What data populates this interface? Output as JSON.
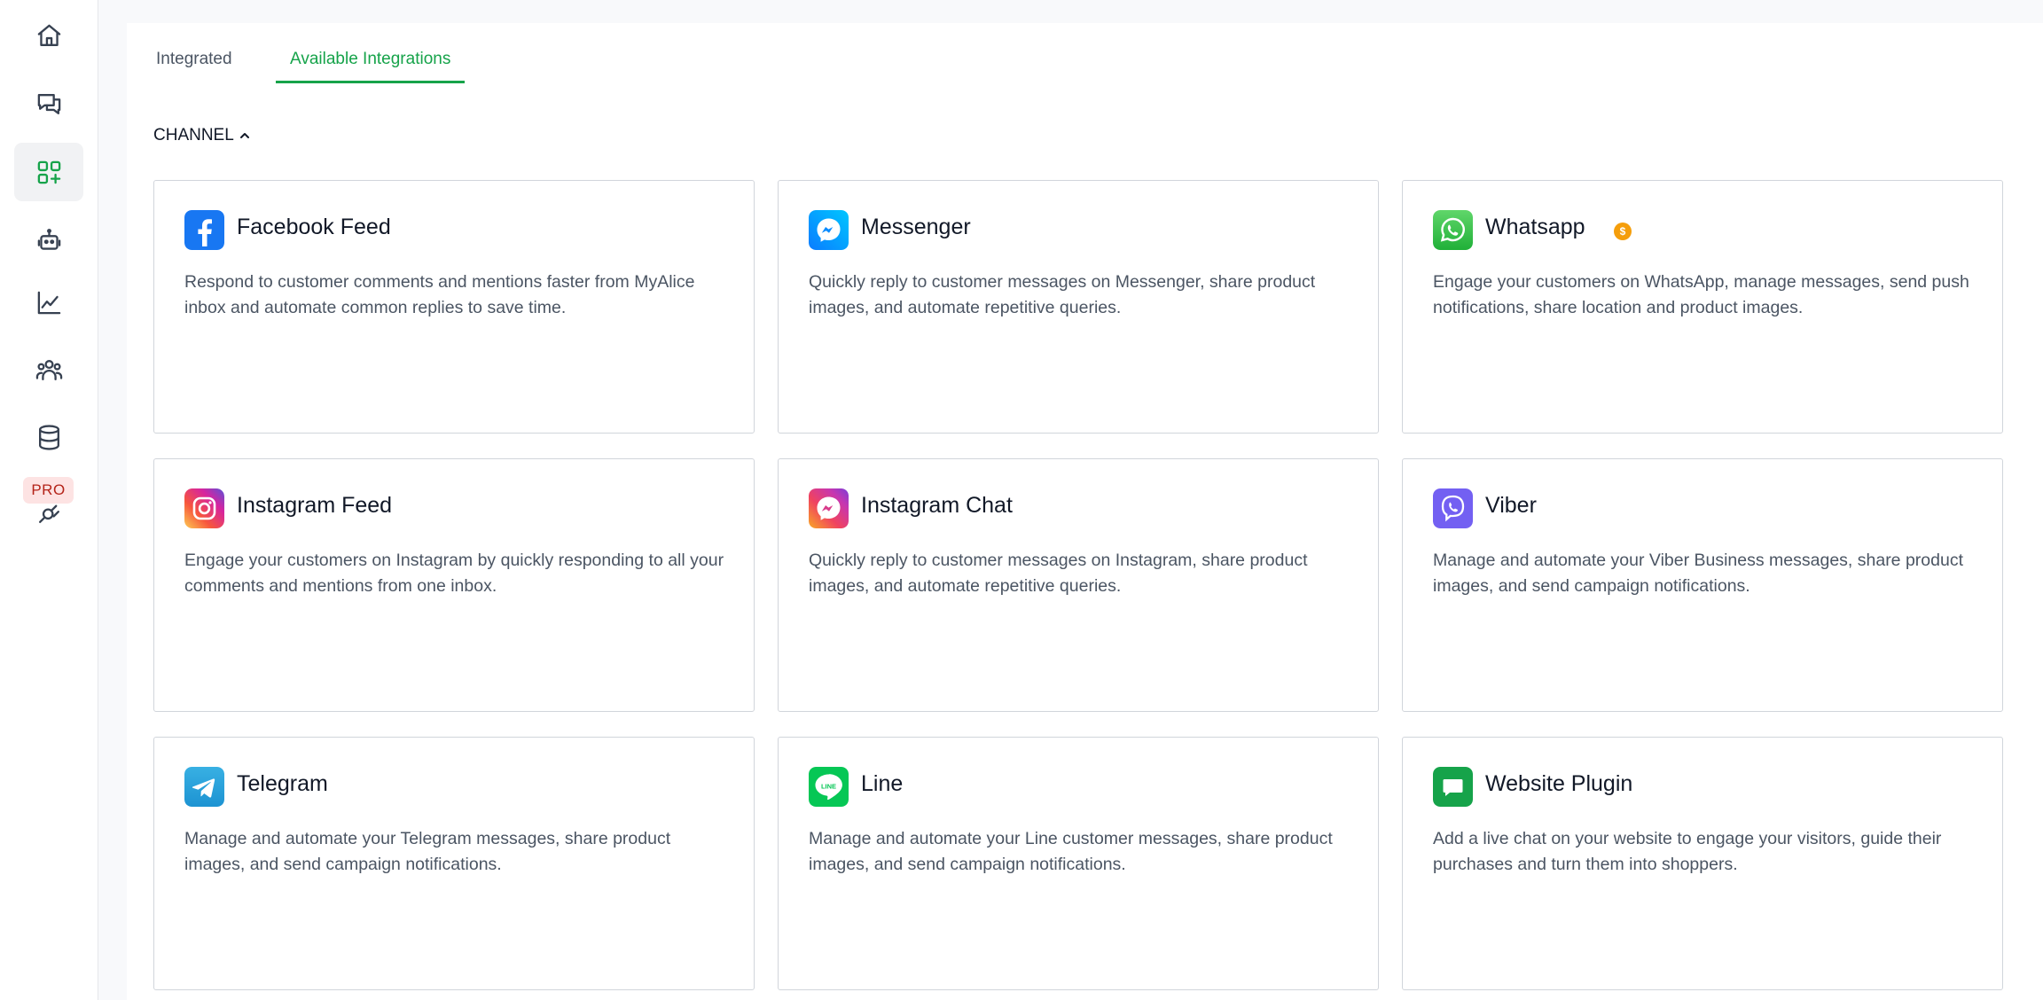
{
  "sidebar": {
    "items": [
      {
        "icon": "home-icon"
      },
      {
        "icon": "chat-icon"
      },
      {
        "icon": "integrations-icon",
        "active": true
      },
      {
        "icon": "bot-icon"
      },
      {
        "icon": "analytics-icon"
      },
      {
        "icon": "customers-icon"
      },
      {
        "icon": "database-icon"
      },
      {
        "icon": "plug-icon"
      }
    ],
    "pro_badge": "PRO"
  },
  "tabs": [
    {
      "label": "Integrated",
      "active": false
    },
    {
      "label": "Available Integrations",
      "active": true
    }
  ],
  "section": {
    "label": "CHANNEL",
    "icon": "chevron-up-icon"
  },
  "cards": [
    {
      "title": "Facebook Feed",
      "icon": "facebook-icon",
      "description": "Respond to customer comments and mentions faster from MyAlice inbox and automate common replies to save time."
    },
    {
      "title": "Messenger",
      "icon": "messenger-icon",
      "description": "Quickly reply to customer messages on Messenger, share product images, and automate repetitive queries."
    },
    {
      "title": "Whatsapp",
      "icon": "whatsapp-icon",
      "premium_icon": "coin-icon",
      "description": "Engage your customers on WhatsApp, manage messages, send push notifications, share location and product images."
    },
    {
      "title": "Instagram Feed",
      "icon": "instagram-icon",
      "description": "Engage your customers on Instagram by quickly responding to all your comments and mentions from one inbox."
    },
    {
      "title": "Instagram Chat",
      "icon": "instagram-chat-icon",
      "description": "Quickly reply to customer messages on Instagram, share product images, and automate repetitive queries."
    },
    {
      "title": "Viber",
      "icon": "viber-icon",
      "description": "Manage and automate your Viber Business messages, share product images, and send campaign notifications."
    },
    {
      "title": "Telegram",
      "icon": "telegram-icon",
      "description": "Manage and automate your Telegram messages, share product images, and send campaign notifications."
    },
    {
      "title": "Line",
      "icon": "line-icon",
      "description": "Manage and automate your Line customer messages, share product images, and send campaign notifications."
    },
    {
      "title": "Website Plugin",
      "icon": "website-plugin-icon",
      "description": "Add a live chat on your website to engage your visitors, guide their purchases and turn them into shoppers."
    }
  ],
  "colors": {
    "accent": "#16a34a",
    "facebook": "#1877f2",
    "messenger": "#0a9cff",
    "whatsapp": "#25d366",
    "viber": "#7360f2",
    "telegram": "#2aa3e0",
    "line": "#06c755",
    "website": "#16a34a"
  }
}
